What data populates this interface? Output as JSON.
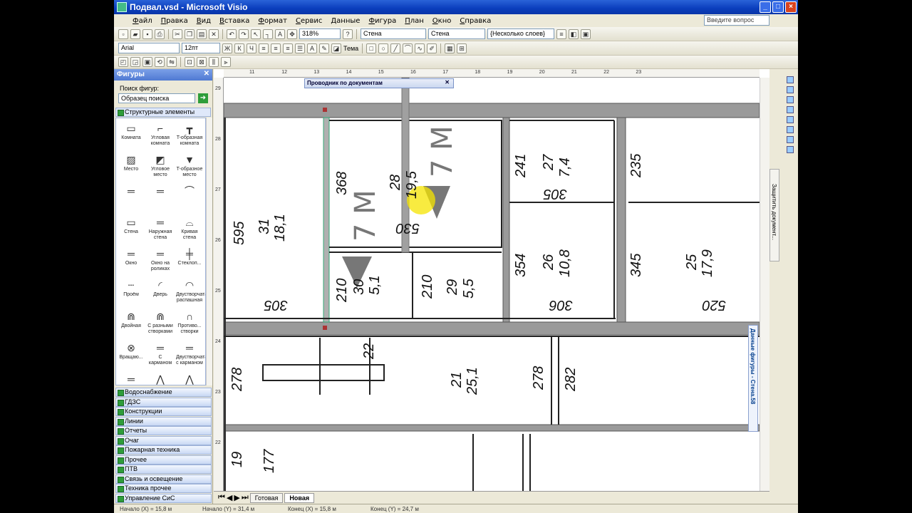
{
  "window": {
    "title": "Подвал.vsd - Microsoft Visio",
    "buttons": [
      "_",
      "□",
      "×"
    ]
  },
  "menu": [
    "Файл",
    "Правка",
    "Вид",
    "Вставка",
    "Формат",
    "Сервис",
    "Данные",
    "Фигура",
    "План",
    "Окно",
    "Справка"
  ],
  "help_placeholder": "Введите вопрос",
  "toolbar": {
    "zoom": "318%",
    "line_style_1": "Стена",
    "line_style_2": "Стена",
    "fill_style": "{Несколько слоев}",
    "font": "Arial",
    "font_size": "12пт",
    "theme_label": "Тема"
  },
  "shapes_panel": {
    "title": "Фигуры",
    "search_label": "Поиск фигур:",
    "search_value": "Образец поиска",
    "open_stencil": "Структурные элементы",
    "shapes": [
      {
        "label": "Комната",
        "glyph": "▭"
      },
      {
        "label": "Угловая комната",
        "glyph": "⌐"
      },
      {
        "label": "T-образная комната",
        "glyph": "┳"
      },
      {
        "label": "Место",
        "glyph": "▨"
      },
      {
        "label": "Угловое место",
        "glyph": "◩"
      },
      {
        "label": "T-образное место",
        "glyph": "▼"
      },
      {
        "label": "",
        "glyph": "═"
      },
      {
        "label": "",
        "glyph": "═"
      },
      {
        "label": "",
        "glyph": "⌒"
      },
      {
        "label": "Стена",
        "glyph": "▭"
      },
      {
        "label": "Наружная стена",
        "glyph": "═"
      },
      {
        "label": "Кривая стена",
        "glyph": "⌓"
      },
      {
        "label": "Окно",
        "glyph": "═"
      },
      {
        "label": "Окно на роликах",
        "glyph": "═"
      },
      {
        "label": "Стеклоп...",
        "glyph": "╪"
      },
      {
        "label": "Проём",
        "glyph": "┄"
      },
      {
        "label": "Дверь",
        "glyph": "◜"
      },
      {
        "label": "Двустворчатая распашная",
        "glyph": "◠"
      },
      {
        "label": "Двойная",
        "glyph": "⋒"
      },
      {
        "label": "С разными створками",
        "glyph": "⋒"
      },
      {
        "label": "Противо... створки",
        "glyph": "∩"
      },
      {
        "label": "Вращаю...",
        "glyph": "⊗"
      },
      {
        "label": "С карманом",
        "glyph": "═"
      },
      {
        "label": "Двустворчатая с карманом",
        "glyph": "═"
      },
      {
        "label": "Обходная",
        "glyph": "═"
      },
      {
        "label": "Складыв...",
        "glyph": "⋀"
      },
      {
        "label": "Двустворчатая складыв...",
        "glyph": "⋀"
      },
      {
        "label": "",
        "glyph": "┝"
      },
      {
        "label": "",
        "glyph": "╤"
      },
      {
        "label": "",
        "glyph": "╥"
      }
    ],
    "stencils": [
      "Водоснабжение",
      "ГДЗС",
      "Конструкции",
      "Линии",
      "Отчеты",
      "Очаг",
      "Пожарная техника",
      "Прочее",
      "ПТВ",
      "Связь и освещение",
      "Техника прочее",
      "Управление СиС"
    ]
  },
  "doc_explorer": "Проводник по документам",
  "shape_data_panel": "Данные фигуры - Стена.58",
  "protect_button": "Защитить документ...",
  "page_tabs": [
    "Готовая",
    "Новая"
  ],
  "ruler_h": [
    "11",
    "12",
    "13",
    "14",
    "15",
    "16",
    "17",
    "18",
    "19",
    "20",
    "21",
    "22",
    "23"
  ],
  "ruler_v": [
    "29",
    "28",
    "27",
    "26",
    "25",
    "24",
    "23",
    "22"
  ],
  "plan_labels": {
    "r1": "595",
    "r1a": "31",
    "r1b": "18,1",
    "r1c": "305",
    "r2": "368",
    "r2a": "28",
    "r2b": "19,5",
    "r2c": "530",
    "r3": "210",
    "r3a": "30",
    "r3b": "5,1",
    "r4": "210",
    "r4a": "29",
    "r4b": "5,5",
    "r5": "241",
    "r5a": "27",
    "r5b": "7,4",
    "r5c": "305",
    "r6": "354",
    "r6a": "26",
    "r6b": "10,8",
    "r6c": "306",
    "r7": "235",
    "r7b": "345",
    "r7c": "25",
    "r7d": "17,9",
    "r7e": "520",
    "r8": "278",
    "r8a": "22",
    "r8b": "21",
    "r8c": "25,1",
    "r8d": "278",
    "r8e": "282",
    "r9": "19",
    "r9a": "177",
    "arrow1": "7 М",
    "arrow2": "7 М"
  },
  "status": {
    "begin_x": "Начало (X) = 15,8 м",
    "begin_y": "Начало (Y) = 31,4 м",
    "end_x": "Конец (X) = 15,8 м",
    "end_y": "Конец (Y) = 24,7 м"
  }
}
